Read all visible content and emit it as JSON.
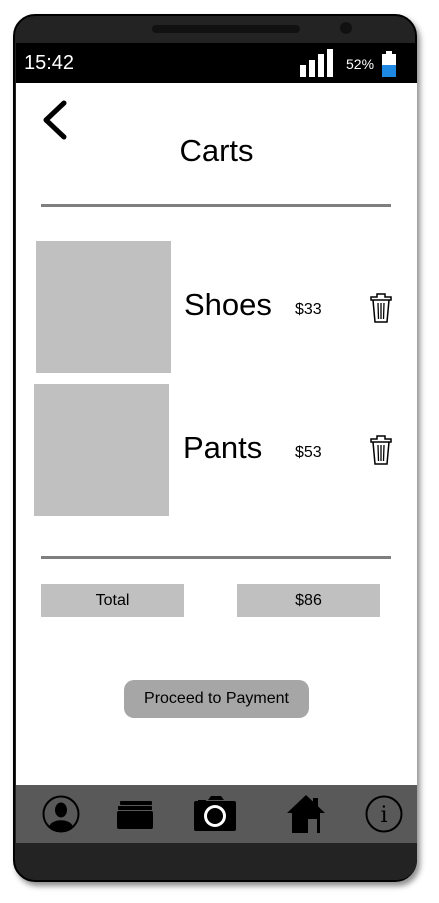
{
  "status_bar": {
    "time": "15:42",
    "battery_percent": "52%",
    "battery_level": 0.52,
    "battery_color": "#1e88e5"
  },
  "header": {
    "back_icon": "chevron-left-icon",
    "title": "Carts"
  },
  "cart": {
    "items": [
      {
        "name": "Shoes",
        "price": "$33",
        "thumbnail_color": "#c0c0c0",
        "delete_icon": "trash-icon"
      },
      {
        "name": "Pants",
        "price": "$53",
        "thumbnail_color": "#c0c0c0",
        "delete_icon": "trash-icon"
      }
    ]
  },
  "summary": {
    "total_label": "Total",
    "total_value": "$86"
  },
  "actions": {
    "proceed_label": "Proceed to Payment"
  },
  "tab_bar": {
    "tabs": [
      {
        "icon": "profile-icon"
      },
      {
        "icon": "cards-icon"
      },
      {
        "icon": "camera-icon"
      },
      {
        "icon": "home-icon"
      },
      {
        "icon": "info-icon"
      }
    ]
  },
  "colors": {
    "phone_body": "#232323",
    "tab_bar": "#595959",
    "placeholder_gray": "#c0c0c0",
    "button_gray": "#a6a6a6",
    "divider": "#7f7f7f"
  }
}
